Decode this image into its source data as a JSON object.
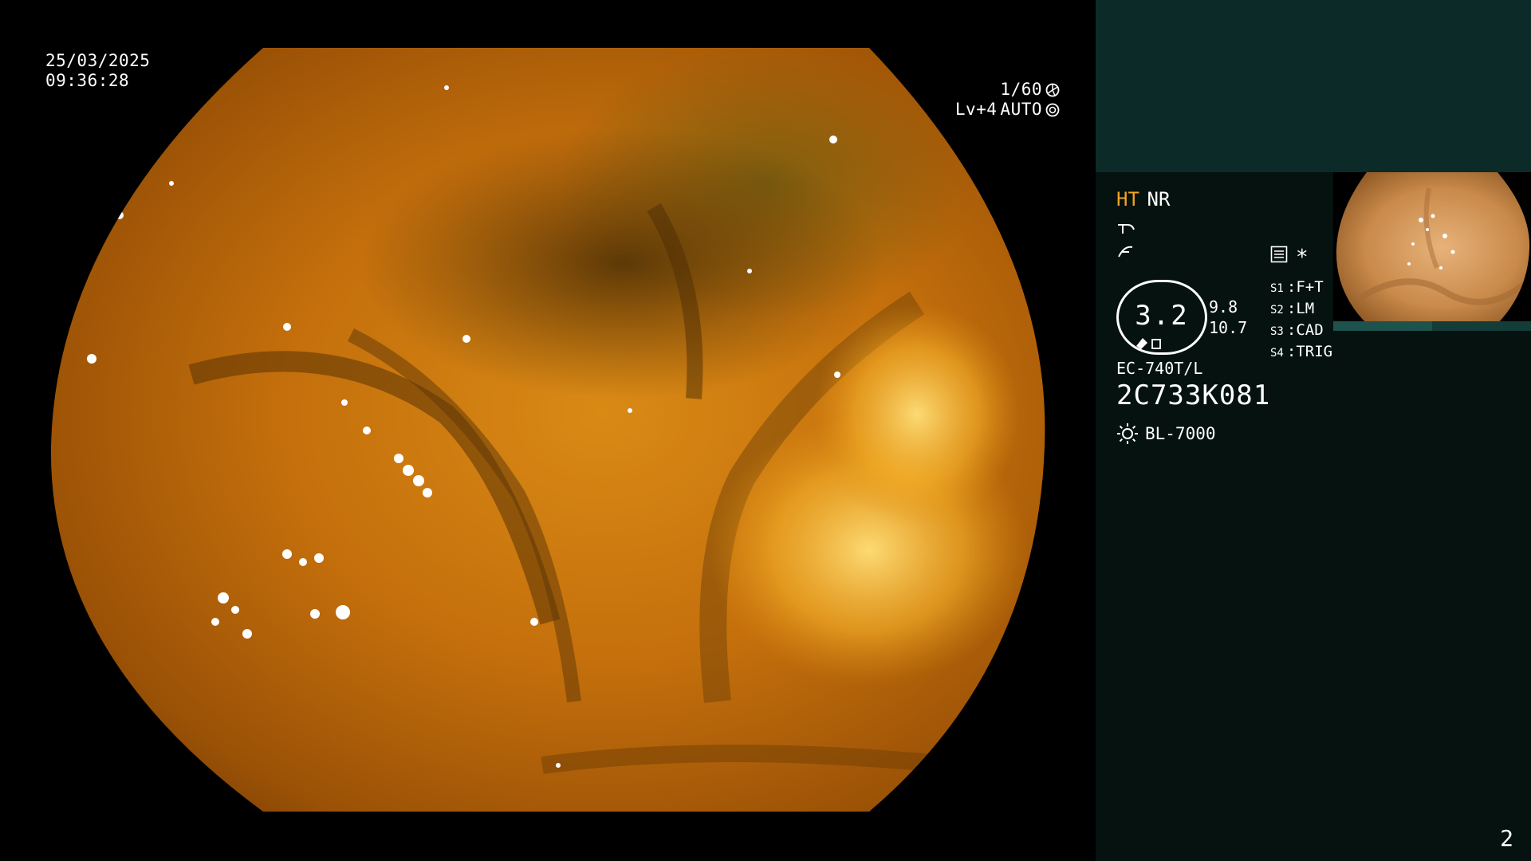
{
  "viewport": {
    "date": "25/03/2025",
    "time": "09:36:28",
    "shutter": "1/60",
    "level": "Lv+4",
    "mode": "AUTO"
  },
  "panel": {
    "mode_ht": "HT",
    "mode_nr": "NR",
    "zoom": "3.2",
    "zoom_side_top": "9.8",
    "zoom_side_bottom": "10.7",
    "asterisk": "*",
    "scenes": [
      {
        "label": "S1",
        "value": "F+T"
      },
      {
        "label": "S2",
        "value": "LM"
      },
      {
        "label": "S3",
        "value": "CAD"
      },
      {
        "label": "S4",
        "value": "TRIG"
      }
    ],
    "scope_model": "EC-740T/L",
    "scope_serial": "2C733K081",
    "light_source": "BL-7000",
    "page_number": "2"
  },
  "colors": {
    "panel_bg": "#05120f",
    "panel_top": "#0c2a28",
    "accent_ht": "#f2a320",
    "tissue": "#c9780f"
  },
  "icons": [
    "aperture-icon",
    "auto-iris-icon",
    "pump-icon",
    "filter-icon",
    "menu-icon",
    "light-icon"
  ]
}
